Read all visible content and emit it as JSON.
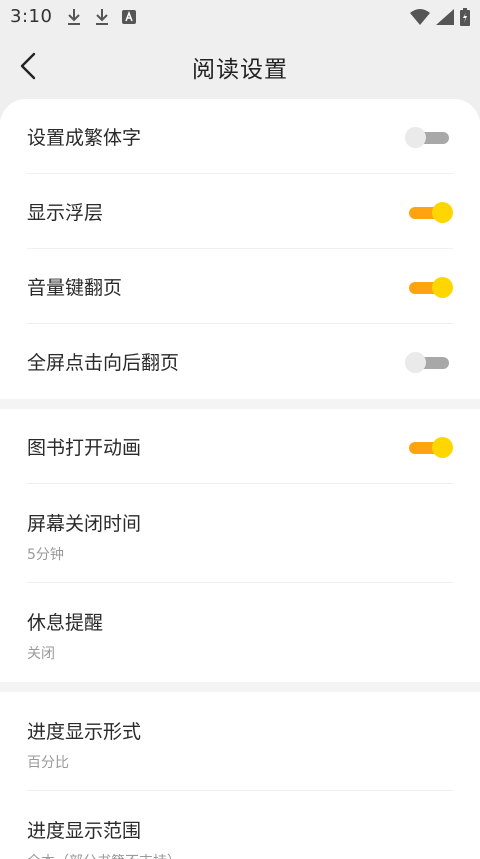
{
  "status": {
    "time": "3:10",
    "left_icons": [
      "download-icon",
      "download-icon",
      "font-icon"
    ],
    "right_icons": [
      "wifi-icon",
      "signal-icon",
      "battery-icon"
    ]
  },
  "header": {
    "title": "阅读设置",
    "back_icon": "chevron-left-icon"
  },
  "colors": {
    "toggle_on_track": "#ffa311",
    "toggle_on_knob": "#ffd600",
    "toggle_off_track": "#a8a8a8",
    "toggle_off_knob": "#eaeaea"
  },
  "settings": {
    "group1": [
      {
        "label": "设置成繁体字",
        "enabled": false
      },
      {
        "label": "显示浮层",
        "enabled": true
      },
      {
        "label": "音量键翻页",
        "enabled": true
      },
      {
        "label": "全屏点击向后翻页",
        "enabled": false
      }
    ],
    "group2": {
      "book_animation": {
        "label": "图书打开动画",
        "enabled": true
      },
      "screen_off": {
        "label": "屏幕关闭时间",
        "value": "5分钟"
      },
      "rest_reminder": {
        "label": "休息提醒",
        "value": "关闭"
      }
    },
    "group3": {
      "progress_format": {
        "label": "进度显示形式",
        "value": "百分比"
      },
      "progress_range": {
        "label": "进度显示范围",
        "value": "全本（部分书籍不支持）"
      }
    }
  }
}
